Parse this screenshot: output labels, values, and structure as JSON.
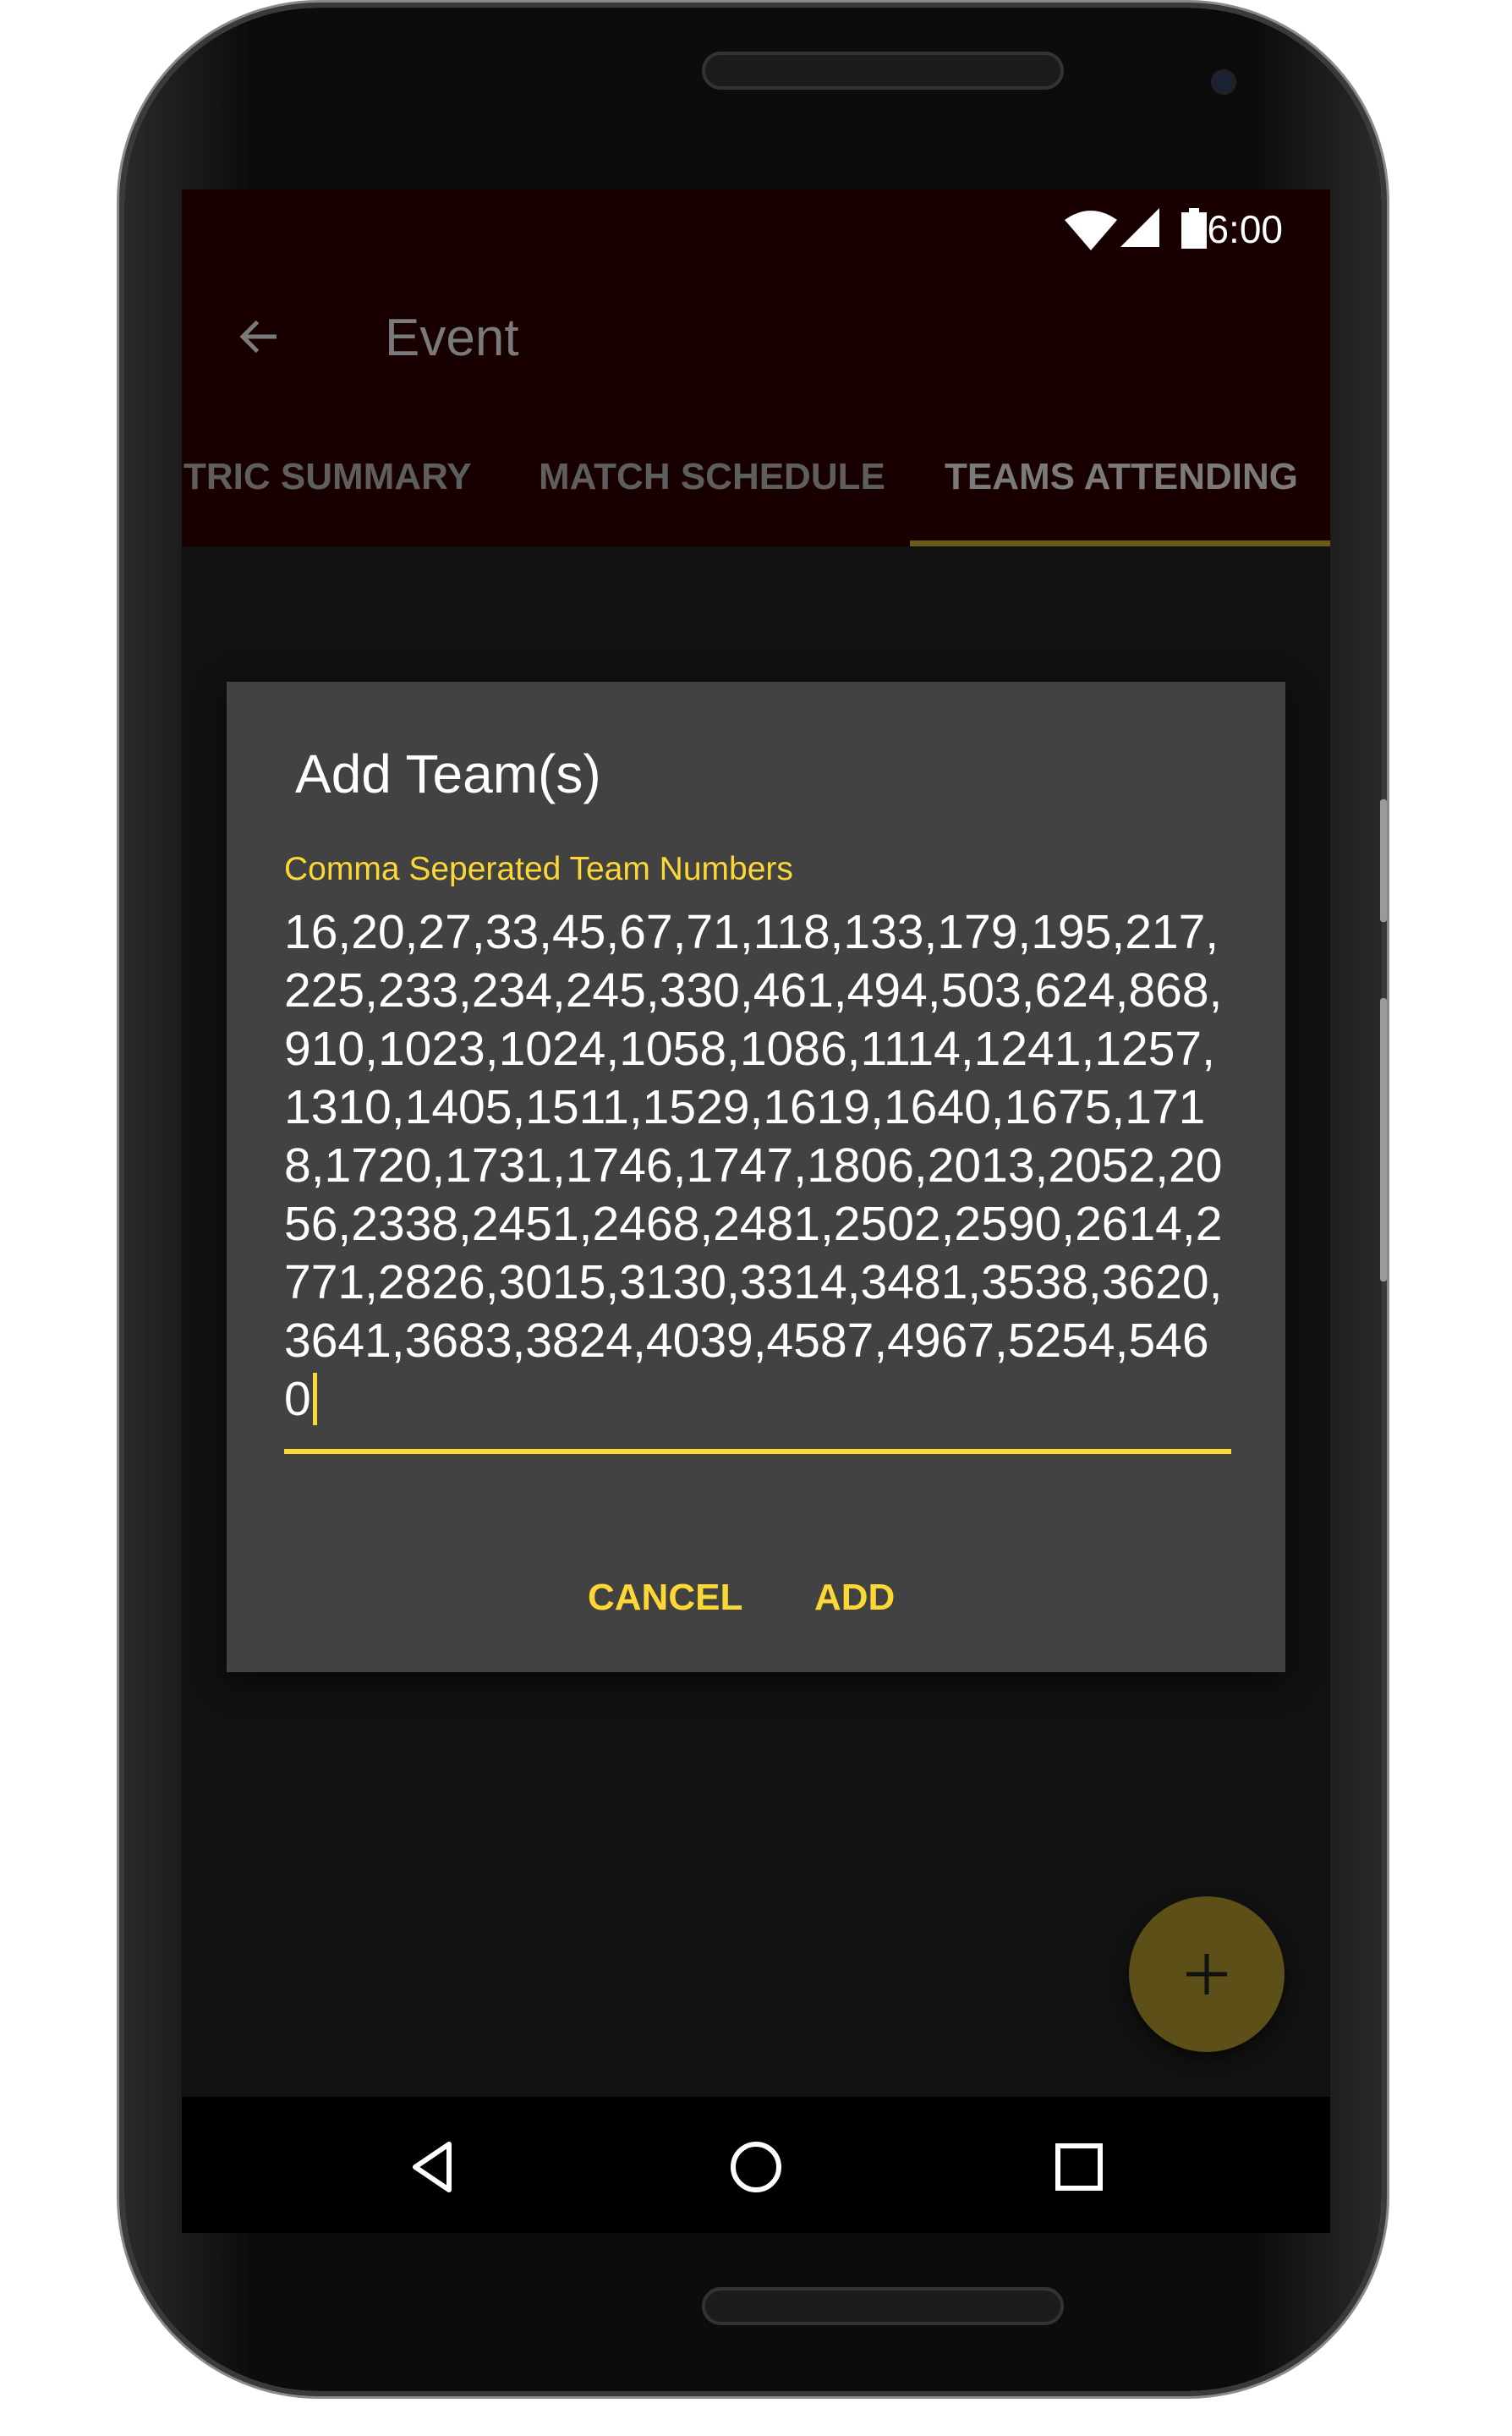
{
  "status_bar": {
    "time": "6:00"
  },
  "toolbar": {
    "title": "Event"
  },
  "tabs": [
    {
      "label": "TRIC SUMMARY",
      "active": false
    },
    {
      "label": "MATCH SCHEDULE",
      "active": false
    },
    {
      "label": "TEAMS ATTENDING",
      "active": true
    }
  ],
  "dialog": {
    "title": "Add Team(s)",
    "field_label": "Comma Seperated Team Numbers",
    "field_value": "16,20,27,33,45,67,71,118,133,179,195,217,225,233,234,245,330,461,494,503,624,868,910,1023,1024,1058,1086,1114,1241,1257,1310,1405,1511,1529,1619,1640,1675,1718,1720,1731,1746,1747,1806,2013,2052,2056,2338,2451,2468,2481,2502,2590,2614,2771,2826,3015,3130,3314,3481,3538,3620,3641,3683,3824,4039,4587,4967,5254,5460",
    "cancel_label": "CANCEL",
    "add_label": "ADD"
  },
  "colors": {
    "accent": "#fdd835",
    "toolbar": "#180000",
    "dialog": "#424242",
    "fab": "#5c4f17"
  },
  "icons": {
    "back": "arrow-left-icon",
    "fab": "plus-icon",
    "nav": [
      "back-triangle-icon",
      "home-circle-icon",
      "recents-square-icon"
    ]
  }
}
